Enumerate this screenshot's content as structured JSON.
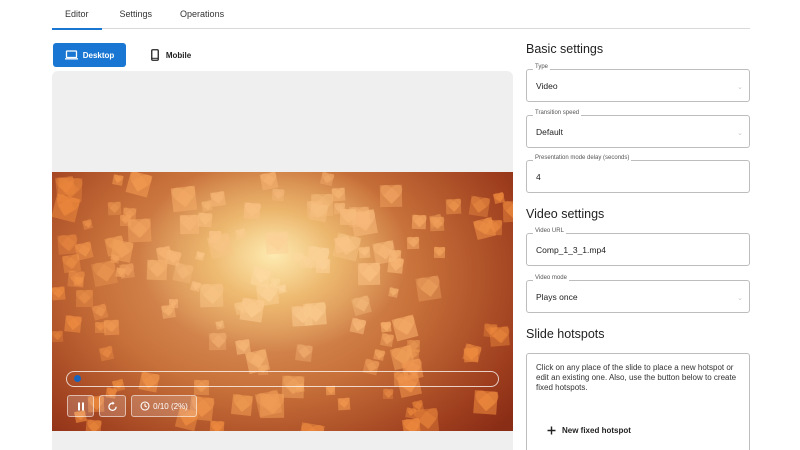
{
  "tabs": [
    "Editor",
    "Settings",
    "Operations"
  ],
  "device": {
    "desktop_label": "Desktop",
    "mobile_label": "Mobile"
  },
  "player": {
    "time_label": "0/10 (2%)",
    "progress": 0.02
  },
  "basic_settings": {
    "title": "Basic settings",
    "type": {
      "label": "Type",
      "value": "Video"
    },
    "transition_speed": {
      "label": "Transition speed",
      "value": "Default"
    },
    "presentation_delay": {
      "label": "Presentation mode delay (seconds)",
      "value": "4"
    }
  },
  "video_settings": {
    "title": "Video settings",
    "video_url": {
      "label": "Video URL",
      "value": "Comp_1_3_1.mp4"
    },
    "video_mode": {
      "label": "Video mode",
      "value": "Plays once"
    }
  },
  "slide_hotspots": {
    "title": "Slide hotspots",
    "description": "Click on any place of the slide to place a new hotspot or edit an existing one. Also, use the button below to create fixed hotspots.",
    "new_button_label": "New fixed hotspot"
  },
  "colors": {
    "accent": "#1976d2"
  }
}
